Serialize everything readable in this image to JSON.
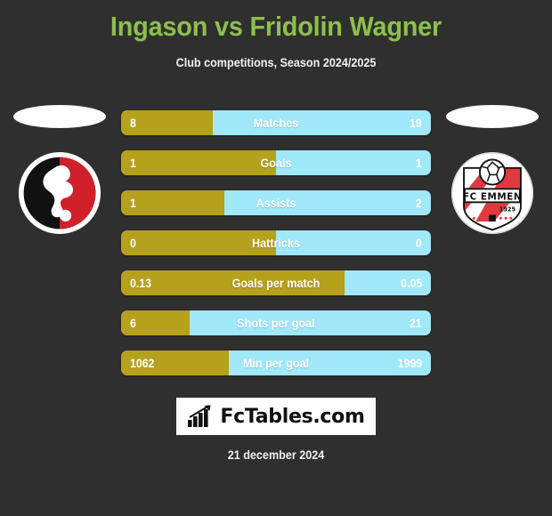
{
  "header": {
    "title": "Ingason vs Fridolin Wagner",
    "subtitle": "Club competitions, Season 2024/2025"
  },
  "footer": {
    "brand_name": "FcTables.com",
    "brand_icon": "bar-chart-growth-icon",
    "date": "21 december 2024"
  },
  "teams": {
    "home": {
      "crest_name": "home-club-crest",
      "crest_colors": {
        "primary": "#d0212b",
        "secondary": "#111111",
        "ring": "#ffffff"
      }
    },
    "away": {
      "crest_name": "fc-emmen-crest",
      "crest_title": "FC EMMEN",
      "crest_year": "1925",
      "crest_colors": {
        "primary": "#e03a3e",
        "secondary": "#ffffff",
        "ring": "#111111"
      }
    }
  },
  "colors": {
    "background": "#2f2f2f",
    "title": "#8dc04a",
    "home_bar": "#b5a11b",
    "away_bar": "#a0e8fa",
    "text": "#ffffff"
  },
  "chart_data": {
    "type": "bar",
    "title": "Ingason vs Fridolin Wagner",
    "subtitle": "Club competitions, Season 2024/2025",
    "orientation": "horizontal-diverging",
    "legend_position": "none",
    "series": [
      {
        "name": "Ingason",
        "color": "#b5a11b",
        "values": [
          8,
          1,
          1,
          0,
          0.13,
          6,
          1062
        ]
      },
      {
        "name": "Fridolin Wagner",
        "color": "#a0e8fa",
        "values": [
          19,
          1,
          2,
          0,
          0.05,
          21,
          1999
        ]
      }
    ],
    "categories": [
      "Matches",
      "Goals",
      "Assists",
      "Hattricks",
      "Goals per match",
      "Shots per goal",
      "Min per goal"
    ],
    "rows": [
      {
        "label": "Matches",
        "home": "8",
        "away": "19",
        "home_pct": 29.6
      },
      {
        "label": "Goals",
        "home": "1",
        "away": "1",
        "home_pct": 50.0
      },
      {
        "label": "Assists",
        "home": "1",
        "away": "2",
        "home_pct": 33.3
      },
      {
        "label": "Hattricks",
        "home": "0",
        "away": "0",
        "home_pct": 50.0
      },
      {
        "label": "Goals per match",
        "home": "0.13",
        "away": "0.05",
        "home_pct": 72.2
      },
      {
        "label": "Shots per goal",
        "home": "6",
        "away": "21",
        "home_pct": 22.2
      },
      {
        "label": "Min per goal",
        "home": "1062",
        "away": "1999",
        "home_pct": 34.7
      }
    ]
  }
}
